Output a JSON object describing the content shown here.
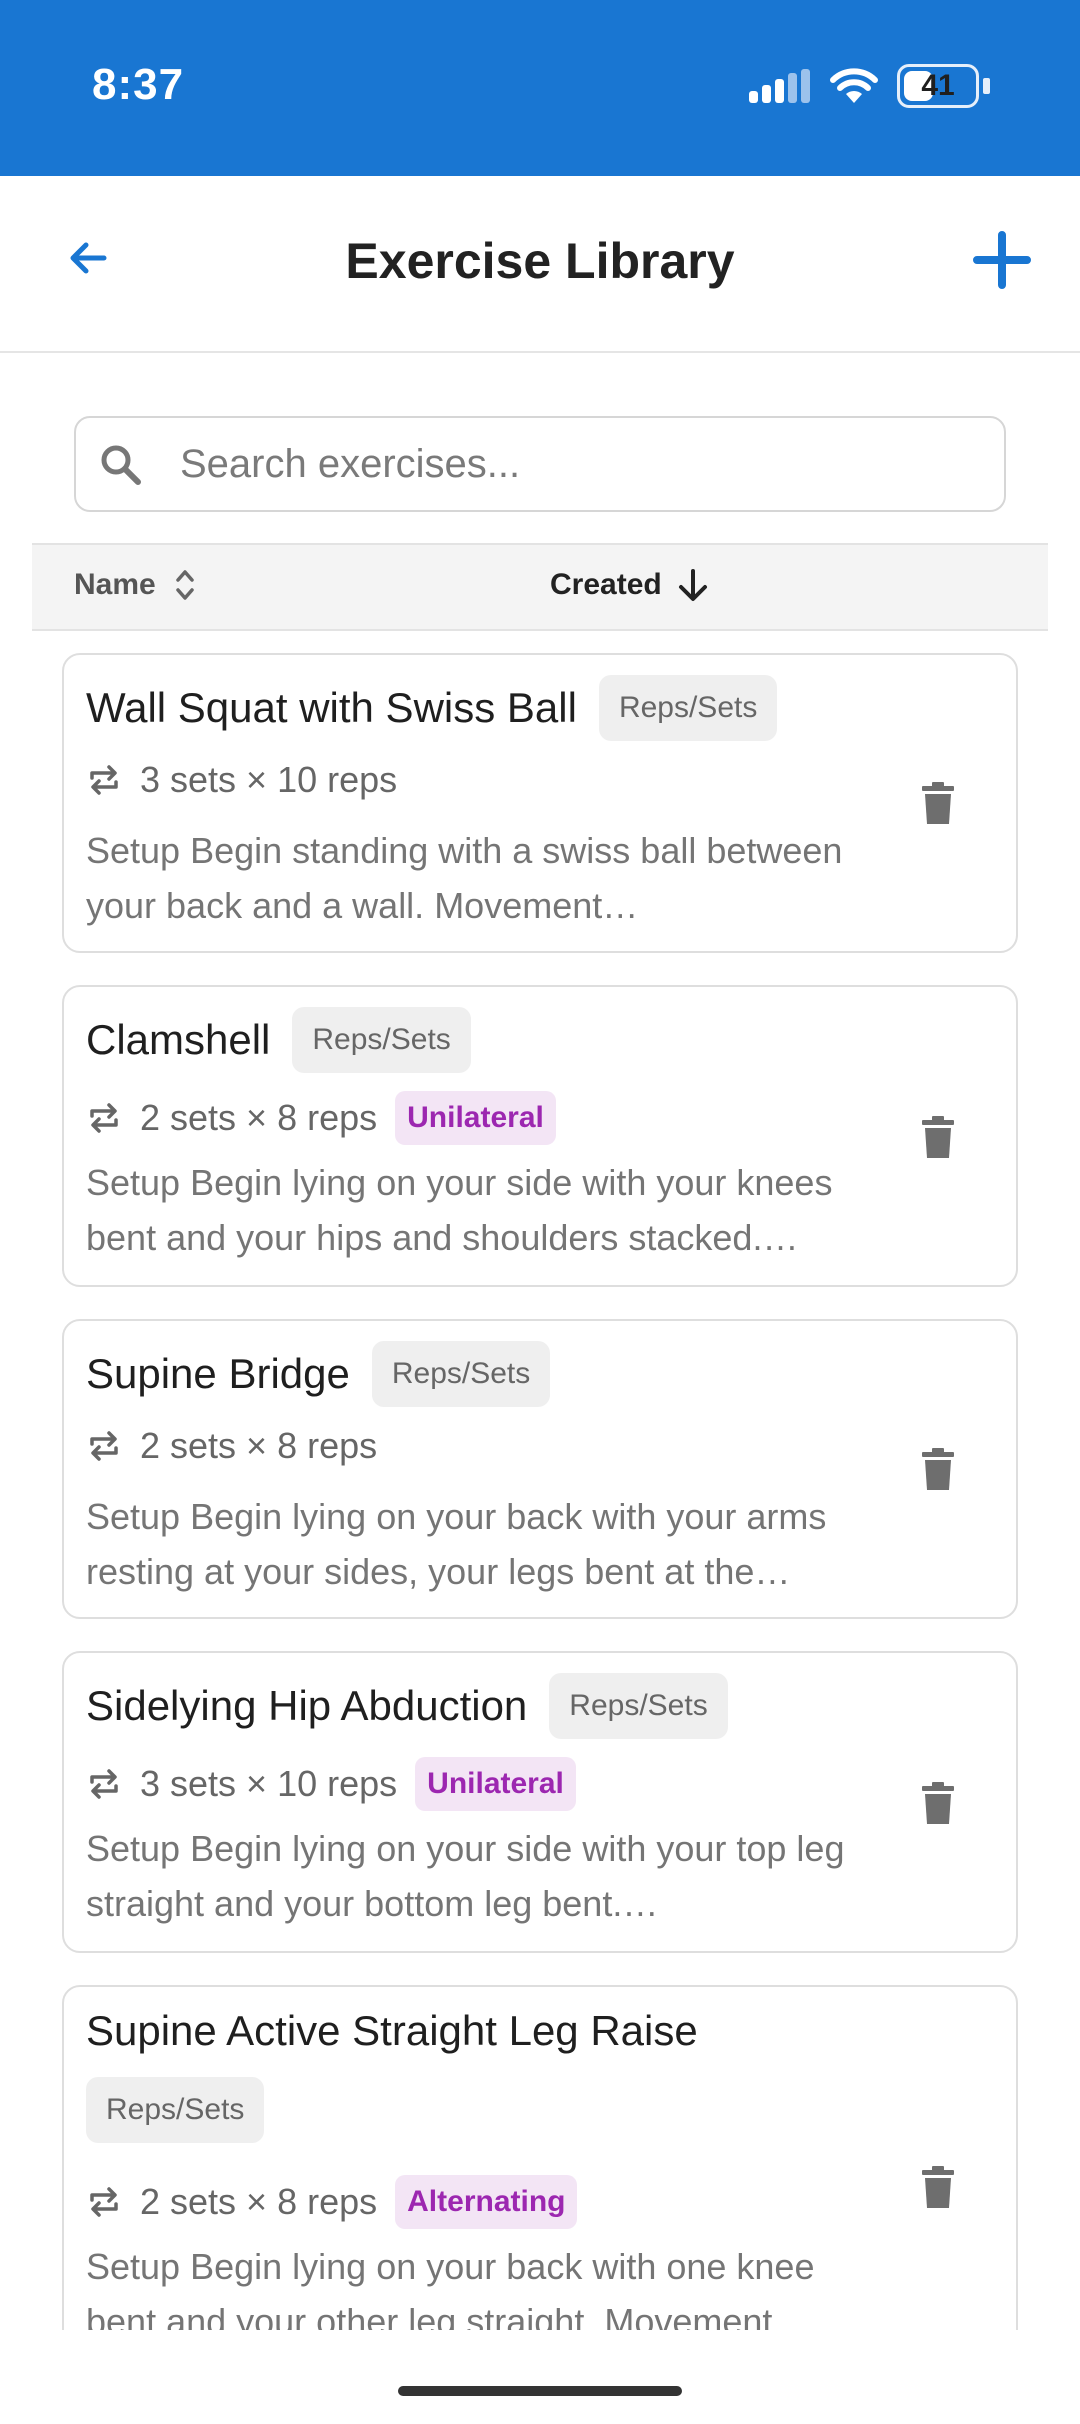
{
  "status_bar": {
    "time": "8:37",
    "battery": "41",
    "battery_level": 0.41
  },
  "app_bar": {
    "title": "Exercise Library",
    "back_icon": "arrow-back-icon",
    "add_icon": "plus-icon"
  },
  "search": {
    "placeholder": "Search exercises...",
    "value": ""
  },
  "sort_header": {
    "name_label": "Name",
    "created_label": "Created"
  },
  "exercises": [
    {
      "name": "Wall Squat with Swiss Ball",
      "type": "Reps/Sets",
      "volume": "3 sets × 10 reps",
      "side": "",
      "description": "Setup Begin standing with a swiss ball between your back and a wall. Movement…"
    },
    {
      "name": "Clamshell",
      "type": "Reps/Sets",
      "volume": "2 sets × 8 reps",
      "side": "Unilateral",
      "description": "Setup Begin lying on your side with your knees bent and your hips and shoulders stacked.…"
    },
    {
      "name": "Supine Bridge",
      "type": "Reps/Sets",
      "volume": "2 sets × 8 reps",
      "side": "",
      "description": "Setup Begin lying on your back with your arms resting at your sides, your legs bent at the…"
    },
    {
      "name": "Sidelying Hip Abduction",
      "type": "Reps/Sets",
      "volume": "3 sets × 10 reps",
      "side": "Unilateral",
      "description": "Setup Begin lying on your side with your top leg straight and your bottom leg bent.…"
    },
    {
      "name": "Supine Active Straight Leg Raise",
      "type": "Reps/Sets",
      "volume": "2 sets × 8 reps",
      "side": "Alternating",
      "description": "Setup Begin lying on your back with one knee bent and your other leg straight. Movement"
    }
  ],
  "colors": {
    "primary": "#1976d2",
    "side_chip_text": "#9c27b0",
    "side_chip_bg": "#f3e5f5"
  }
}
